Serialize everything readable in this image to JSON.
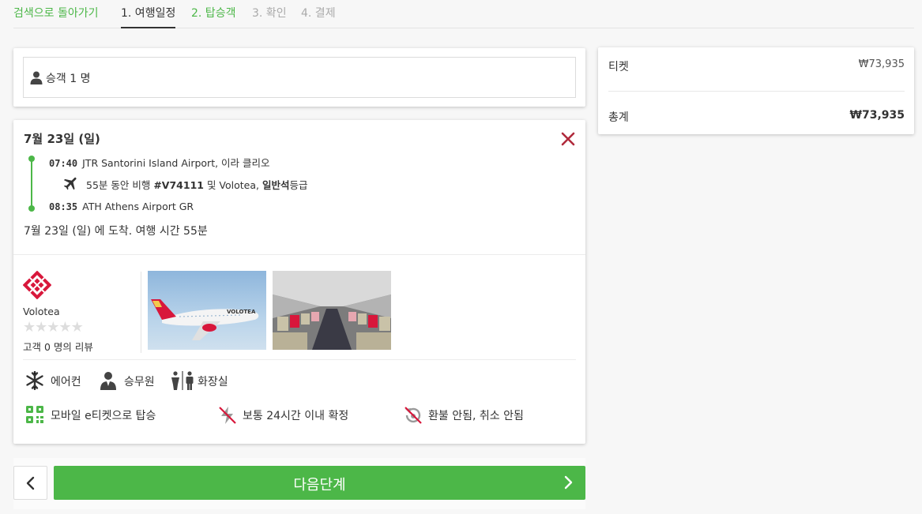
{
  "steps": {
    "back": "검색으로 돌아가기",
    "step1": "1. 여행일정",
    "step2": "2. 탑승객",
    "step3": "3. 확인",
    "step4": "4. 결제"
  },
  "passengers": {
    "icon": "person-icon",
    "label": "승객 1 명"
  },
  "itinerary": {
    "date": "7월 23일 (일)",
    "close_icon": "close-icon",
    "departure": {
      "time": "07:40",
      "place": "JTR Santorini Island Airport, 이라 클리오"
    },
    "flight": {
      "icon": "plane-icon",
      "duration_text": "55분 동안 비행 ",
      "number": "#V74111",
      "mid_text": " 및 Volotea, ",
      "class": "일반석",
      "class_suffix": "등급"
    },
    "arrival": {
      "time": "08:35",
      "place": "ATH Athens Airport GR"
    },
    "arrive_summary": "7월 23일 (일) 에 도착. 여행 시간 55분"
  },
  "airline": {
    "name": "Volotea",
    "rating": 0,
    "rating_max": 5,
    "reviews": "고객 0 명의 리뷰",
    "brand_color": "#d8173b"
  },
  "amenities": {
    "ac": {
      "icon": "snowflake-icon",
      "label": "에어컨"
    },
    "crew": {
      "icon": "attendant-icon",
      "label": "승무원"
    },
    "toilet": {
      "icon": "toilet-icon",
      "label": "화장실"
    },
    "eticket": {
      "icon": "qr-code-icon",
      "label": "모바일 e티켓으로 탑승"
    },
    "confirm": {
      "icon": "no-instant-icon",
      "label": "보통 24시간 이내 확정"
    },
    "refund": {
      "icon": "no-refund-icon",
      "label": "환불 안됨, 취소 안됨"
    }
  },
  "nav": {
    "next_label": "다음단계"
  },
  "summary": {
    "ticket_label": "티켓",
    "ticket_price": "₩73,935",
    "total_label": "총계",
    "total_price": "₩73,935"
  },
  "colors": {
    "accent": "#4cb748",
    "close": "#b02a3c"
  }
}
